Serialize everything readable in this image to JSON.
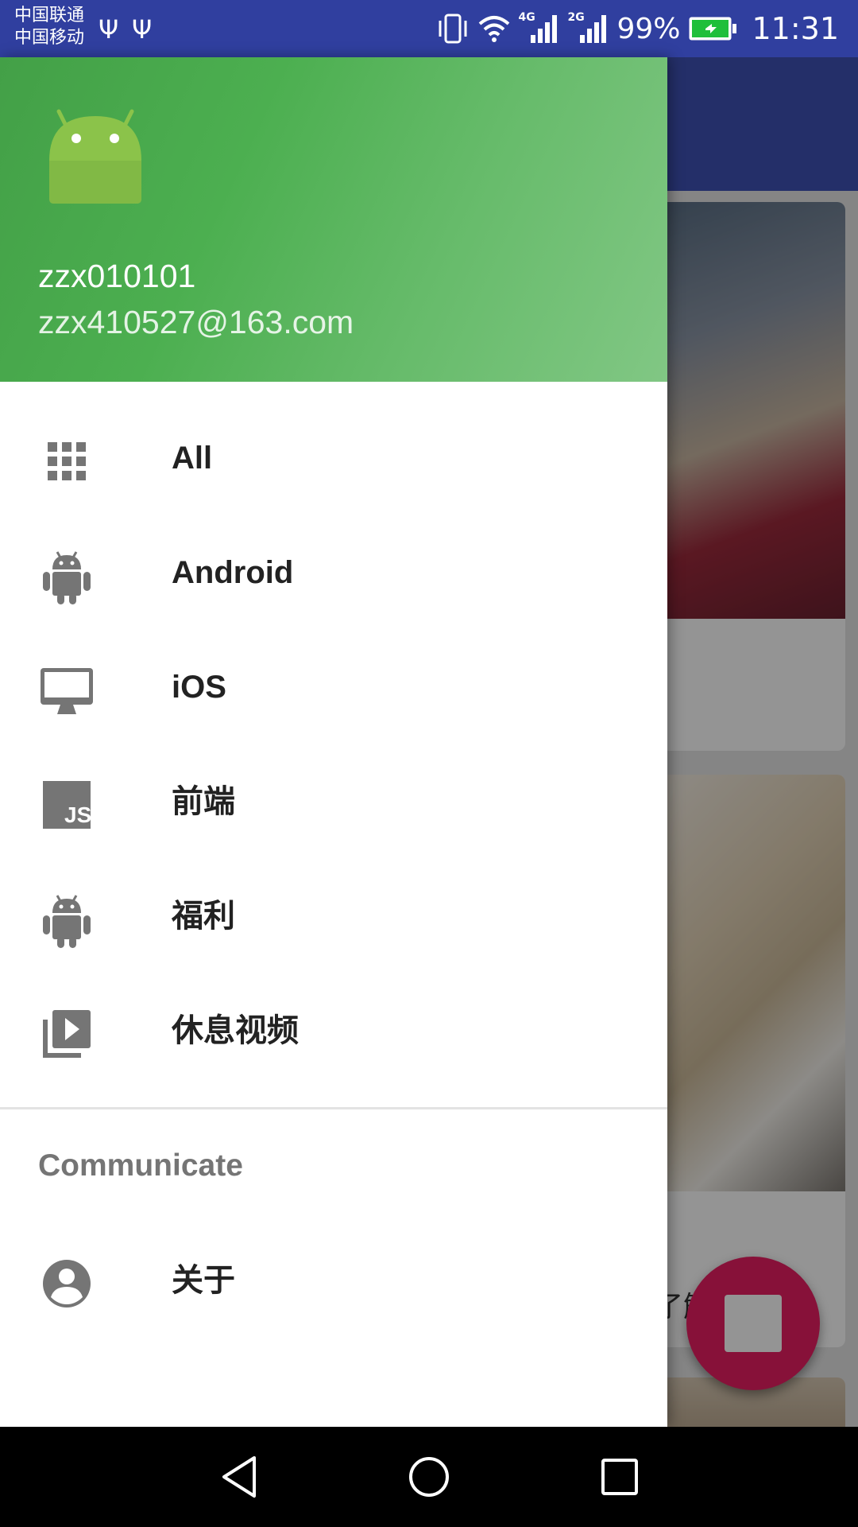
{
  "status_bar": {
    "carrier_1": "中国联通",
    "carrier_2": "中国移动",
    "network_1": "4G",
    "network_2": "2G",
    "battery": "99%",
    "time": "11:31"
  },
  "drawer": {
    "header": {
      "username": "zzx010101",
      "email": "zzx410527@163.com"
    },
    "items": [
      {
        "label": "All",
        "icon": "apps-grid-icon"
      },
      {
        "label": "Android",
        "icon": "android-icon"
      },
      {
        "label": "iOS",
        "icon": "desktop-mac-icon"
      },
      {
        "label": "前端",
        "icon": "javascript-icon"
      },
      {
        "label": "福利",
        "icon": "android-icon"
      },
      {
        "label": "休息视频",
        "icon": "video-library-icon"
      }
    ],
    "section_title": "Communicate",
    "about": {
      "label": "关于",
      "icon": "account-circle-icon"
    }
  },
  "background": {
    "partial_text": "了解 的"
  },
  "colors": {
    "status_bar": "#303f9f",
    "toolbar": "#3f51b5",
    "header_green": "#4caf50",
    "fab": "#e91e63",
    "icon_gray": "#757575"
  }
}
